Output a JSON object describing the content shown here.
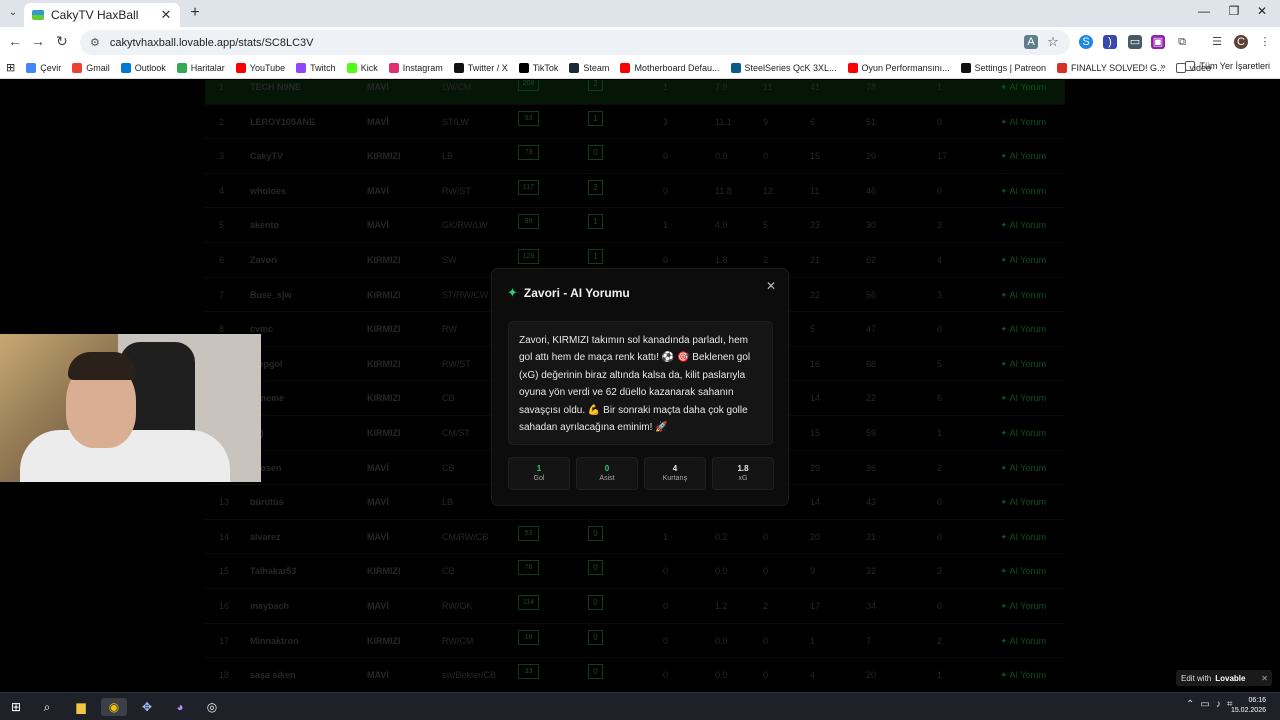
{
  "browser": {
    "tab_title": "CakyTV HaxBall",
    "url": "cakytvhaxball.lovable.app/stats/SC8LC3V",
    "bookmarks": [
      "Çevir",
      "Gmail",
      "Outlook",
      "Haritalar",
      "YouTube",
      "Twitch",
      "Kick",
      "Instagram",
      "Twitter / X",
      "TikTok",
      "Steam",
      "Motherboard Defau...",
      "SteelSeries QcK 3XL...",
      "Oyun Performansını...",
      "Settings | Patreon",
      "FINALLY SOLVED! G...",
      "video"
    ],
    "all_bookmarks": "Tüm Yer İşaretleri",
    "more": "»",
    "profile_initial": "C"
  },
  "table": {
    "rows": [
      {
        "rank": "1",
        "name": "TECH N9NE",
        "team": "MAVİ",
        "pos": "LW/CM",
        "rating": "208",
        "goal": "2",
        "ast": "1",
        "xg": "7.9",
        "sav": "11",
        "duel": "41",
        "touch": "78",
        "score": "1",
        "ai": "AI Yorum"
      },
      {
        "rank": "2",
        "name": "LEROY105ANE",
        "team": "MAVİ",
        "pos": "ST/LW",
        "rating": "93",
        "goal": "1",
        "ast": "3",
        "xg": "11.1",
        "sav": "9",
        "duel": "6",
        "touch": "51",
        "score": "0",
        "ai": "AI Yorum"
      },
      {
        "rank": "3",
        "name": "CakyTV",
        "team": "KIRMIZI",
        "pos": "LB",
        "rating": "73",
        "goal": "0",
        "ast": "0",
        "xg": "0.0",
        "sav": "0",
        "duel": "15",
        "touch": "20",
        "score": "17",
        "ai": "AI Yorum"
      },
      {
        "rank": "4",
        "name": "wholoes",
        "team": "MAVİ",
        "pos": "RW/ST",
        "rating": "117",
        "goal": "2",
        "ast": "0",
        "xg": "11.8",
        "sav": "12",
        "duel": "11",
        "touch": "46",
        "score": "0",
        "ai": "AI Yorum"
      },
      {
        "rank": "5",
        "name": "akento",
        "team": "MAVİ",
        "pos": "GK/RW/LW",
        "rating": "99",
        "goal": "1",
        "ast": "1",
        "xg": "4.0",
        "sav": "5",
        "duel": "23",
        "touch": "30",
        "score": "3",
        "ai": "AI Yorum"
      },
      {
        "rank": "6",
        "name": "Zavori",
        "team": "KIRMIZI",
        "pos": "SW",
        "rating": "128",
        "goal": "1",
        "ast": "0",
        "xg": "1.8",
        "sav": "2",
        "duel": "21",
        "touch": "62",
        "score": "4",
        "ai": "AI Yorum"
      },
      {
        "rank": "7",
        "name": "Buse_sjw",
        "team": "KIRMIZI",
        "pos": "ST/RW/CW",
        "rating": "",
        "goal": "",
        "ast": "",
        "xg": "",
        "sav": "",
        "duel": "22",
        "touch": "56",
        "score": "3",
        "ai": "AI Yorum"
      },
      {
        "rank": "8",
        "name": "cvmc",
        "team": "KIRMIZI",
        "pos": "RW",
        "rating": "",
        "goal": "",
        "ast": "",
        "xg": "",
        "sav": "",
        "duel": "5",
        "touch": "47",
        "score": "0",
        "ai": "AI Yorum"
      },
      {
        "rank": "9",
        "name": "Piepgol",
        "team": "KIRMIZI",
        "pos": "RW/ST",
        "rating": "",
        "goal": "",
        "ast": "",
        "xg": "",
        "sav": "",
        "duel": "16",
        "touch": "68",
        "score": "5",
        "ai": "AI Yorum"
      },
      {
        "rank": "10",
        "name": "deneme",
        "team": "KIRMIZI",
        "pos": "CB",
        "rating": "",
        "goal": "",
        "ast": "",
        "xg": "",
        "sav": "",
        "duel": "14",
        "touch": "22",
        "score": "6",
        "ai": "AI Yorum"
      },
      {
        "rank": "11",
        "name": "a ))",
        "team": "KIRMIZI",
        "pos": "CM/ST",
        "rating": "",
        "goal": "",
        "ast": "",
        "xg": "",
        "sav": "",
        "duel": "15",
        "touch": "59",
        "score": "1",
        "ai": "AI Yorum"
      },
      {
        "rank": "12",
        "name": "chosen",
        "team": "MAVİ",
        "pos": "CB",
        "rating": "",
        "goal": "",
        "ast": "",
        "xg": "",
        "sav": "",
        "duel": "29",
        "touch": "36",
        "score": "2",
        "ai": "AI Yorum"
      },
      {
        "rank": "13",
        "name": "bürütüs",
        "team": "MAVİ",
        "pos": "LB",
        "rating": "",
        "goal": "",
        "ast": "",
        "xg": "",
        "sav": "",
        "duel": "14",
        "touch": "43",
        "score": "0",
        "ai": "AI Yorum"
      },
      {
        "rank": "14",
        "name": "alvarez",
        "team": "MAVİ",
        "pos": "CM/RW/CB",
        "rating": "53",
        "goal": "0",
        "ast": "1",
        "xg": "0.2",
        "sav": "0",
        "duel": "20",
        "touch": "21",
        "score": "0",
        "ai": "AI Yorum"
      },
      {
        "rank": "15",
        "name": "Talhakar53",
        "team": "KIRMIZI",
        "pos": "CB",
        "rating": "76",
        "goal": "0",
        "ast": "0",
        "xg": "0.0",
        "sav": "0",
        "duel": "9",
        "touch": "32",
        "score": "3",
        "ai": "AI Yorum"
      },
      {
        "rank": "16",
        "name": "maybach",
        "team": "MAVİ",
        "pos": "RW/GK",
        "rating": "114",
        "goal": "0",
        "ast": "0",
        "xg": "1.2",
        "sav": "2",
        "duel": "17",
        "touch": "34",
        "score": "0",
        "ai": "AI Yorum"
      },
      {
        "rank": "17",
        "name": "Minnaktron",
        "team": "KIRMIZI",
        "pos": "RW/CM",
        "rating": "18",
        "goal": "0",
        "ast": "0",
        "xg": "0.0",
        "sav": "0",
        "duel": "1",
        "touch": "7",
        "score": "2",
        "ai": "AI Yorum"
      },
      {
        "rank": "18",
        "name": "saşa siken",
        "team": "MAVİ",
        "pos": "sw/Bekler/CB",
        "rating": "33",
        "goal": "0",
        "ast": "0",
        "xg": "0.0",
        "sav": "0",
        "duel": "4",
        "touch": "20",
        "score": "1",
        "ai": "AI Yorum"
      }
    ]
  },
  "modal": {
    "title": "Zavori - AI Yorumu",
    "text": "Zavori, KIRMIZI takımın sol kanadında parladı, hem gol attı hem de maça renk kattı! ⚽ 🎯 Beklenen gol (xG) değerinin biraz altında kalsa da, kilit paslarıyla oyuna yön verdi ve 62 düello kazanarak sahanın savaşçısı oldu. 💪 Bir sonraki maçta daha çok golle sahadan ayrılacağına eminim! 🚀",
    "stats": [
      {
        "value": "1",
        "label": "Gol"
      },
      {
        "value": "0",
        "label": "Asist"
      },
      {
        "value": "4",
        "label": "Kurtarış"
      },
      {
        "value": "1.8",
        "label": "xG"
      }
    ]
  },
  "lovable": {
    "prefix": "Edit with",
    "brand": "Lovable"
  },
  "taskbar": {
    "time": "06:16",
    "date": "15.02.2026"
  },
  "colors": {
    "accent": "#2ecc71",
    "modal_bg": "#0c0c0c",
    "page_bg": "#000000"
  }
}
